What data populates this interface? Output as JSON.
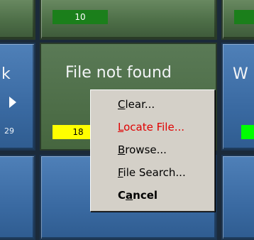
{
  "tiles": {
    "top_badge": "10",
    "left_partial_text": "k",
    "left_number": "29",
    "center_title": "File not found",
    "center_badge": "18",
    "right_partial_text": "W"
  },
  "colors": {
    "badge_green": "#1b7f1b",
    "badge_yellow": "#ffff00",
    "badge_bright_green": "#00ff00",
    "menu_red": "#e00000"
  },
  "context_menu": {
    "items": [
      {
        "mnemonic": "C",
        "rest": "lear..."
      },
      {
        "mnemonic": "L",
        "rest": "ocate File..."
      },
      {
        "mnemonic": "B",
        "rest": "rowse..."
      },
      {
        "mnemonic": "F",
        "rest": "ile Search..."
      },
      {
        "pre": "C",
        "mnemonic": "a",
        "rest": "ncel"
      }
    ]
  }
}
